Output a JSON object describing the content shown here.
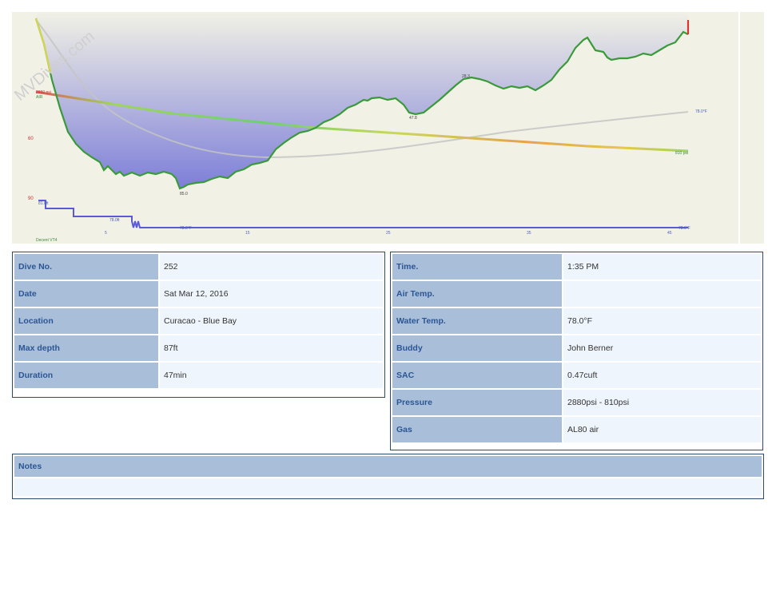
{
  "watermark": "MVDives.com",
  "profile": {
    "x_ticks": [
      "5",
      "15",
      "25",
      "35",
      "45"
    ],
    "depth_labels": [
      "60",
      "90"
    ],
    "start_pressure_label": "2880 psi",
    "start_gas_label": "AIR",
    "end_pressure_label": "810 psi",
    "max_depth_label": "85.0",
    "point_label_1": "47.8",
    "point_label_2": "28.3",
    "temp_label": "78.0°F",
    "ceiling_label_1": "81.0ft",
    "ceiling_label_2": "78.0ft",
    "ceiling_label_3": "78.0°F",
    "ceiling_label_4": "78.0°F",
    "footer_label": "Decent VT4",
    "colors": {
      "background": "#f1f1e6",
      "depth_fill": "#7d7ed8",
      "temperature": "#bfbfbf",
      "tank": "#7de07d",
      "ceiling": "#5a5ad6"
    }
  },
  "details_left": [
    {
      "label": "Dive No.",
      "value": "252"
    },
    {
      "label": "Date",
      "value": "Sat Mar 12, 2016"
    },
    {
      "label": "Location",
      "value": "Curacao - Blue Bay"
    },
    {
      "label": "Max depth",
      "value": "87ft"
    },
    {
      "label": "Duration",
      "value": "47min"
    }
  ],
  "details_right": [
    {
      "label": "Time.",
      "value": "1:35 PM"
    },
    {
      "label": "Air Temp.",
      "value": ""
    },
    {
      "label": "Water Temp.",
      "value": "78.0°F"
    },
    {
      "label": "Buddy",
      "value": "John Berner"
    },
    {
      "label": "SAC",
      "value": "0.47cuft"
    },
    {
      "label": "Pressure",
      "value": "2880psi - 810psi"
    },
    {
      "label": "Gas",
      "value": "AL80 air"
    }
  ],
  "notes": {
    "label": "Notes",
    "value": ""
  }
}
